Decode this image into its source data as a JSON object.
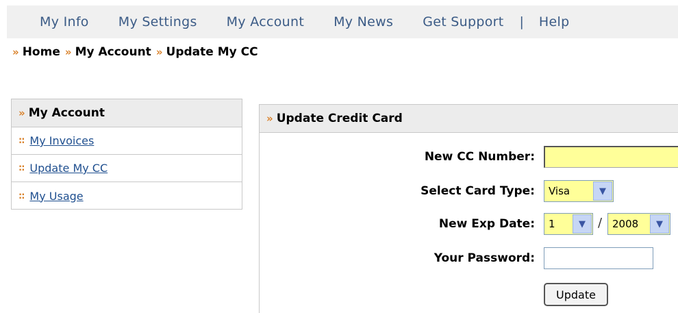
{
  "nav": {
    "items": [
      "My Info",
      "My Settings",
      "My Account",
      "My News",
      "Get Support"
    ],
    "separator": "|",
    "help": "Help"
  },
  "breadcrumb": {
    "marker": "»",
    "home": "Home",
    "account": "My Account",
    "current": "Update My CC"
  },
  "sidebar": {
    "marker": "»",
    "title": "My Account",
    "bullet": "::",
    "items": [
      "My Invoices",
      "Update My CC",
      "My Usage"
    ]
  },
  "panel": {
    "marker": "»",
    "title": "Update Credit Card"
  },
  "form": {
    "cc_label": "New CC Number:",
    "cc_value": "",
    "card_type_label": "Select Card Type:",
    "card_type_value": "Visa",
    "exp_label": "New Exp Date:",
    "exp_month": "1",
    "exp_sep": "/",
    "exp_year": "2008",
    "password_label": "Your Password:",
    "password_value": "",
    "submit_label": "Update"
  },
  "colors": {
    "accent": "#d9822b",
    "link": "#1f4f8f",
    "nav_text": "#3b5b86",
    "input_highlight": "#ffff99"
  }
}
